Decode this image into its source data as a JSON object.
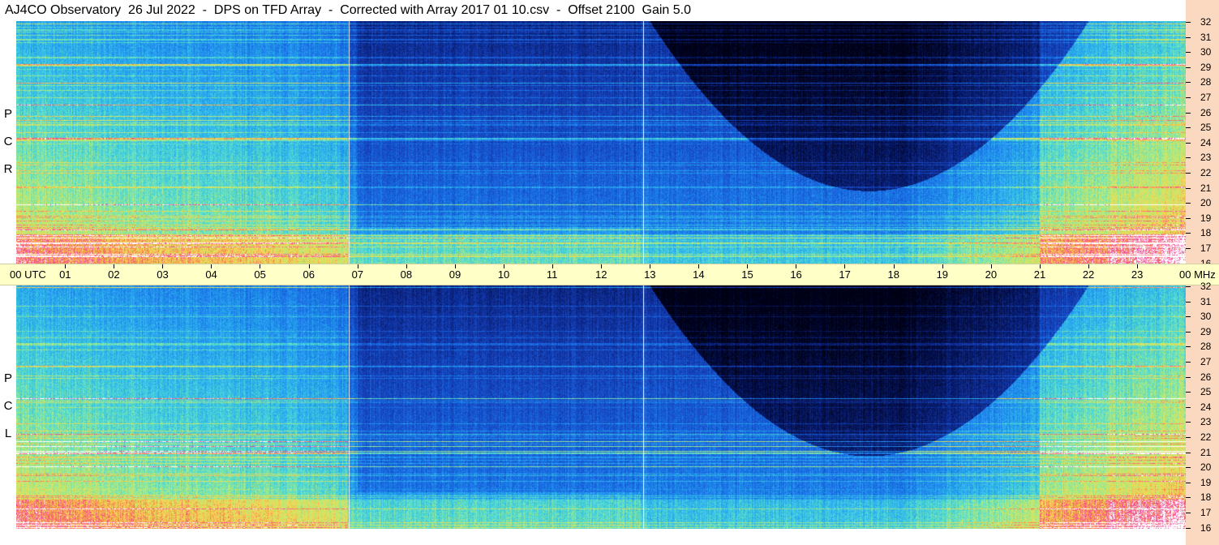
{
  "title": "AJ4CO Observatory  26 Jul 2022  -  DPS on TFD Array  -  Corrected with Array 2017 01 10.csv  -  Offset 2100  Gain 5.0",
  "panels": [
    {
      "name": "rcp",
      "label_letters": [
        "P",
        "C",
        "R"
      ]
    },
    {
      "name": "lcp",
      "label_letters": [
        "P",
        "C",
        "L"
      ]
    }
  ],
  "utc_axis": {
    "first_label": "00 UTC",
    "hour_labels": [
      "01",
      "02",
      "03",
      "04",
      "05",
      "06",
      "07",
      "08",
      "09",
      "10",
      "11",
      "12",
      "13",
      "14",
      "15",
      "16",
      "17",
      "18",
      "19",
      "20",
      "21",
      "22",
      "23"
    ],
    "last_label": "00 MHz"
  },
  "mhz_axis": {
    "labels": [
      "32",
      "31",
      "30",
      "29",
      "28",
      "27",
      "26",
      "25",
      "24",
      "23",
      "22",
      "21",
      "20",
      "19",
      "18",
      "17",
      "16"
    ]
  },
  "colors": {
    "utc_band": "#ffffc8",
    "mhz_band": "#fbd9c0",
    "spectrogram_background": "#0a2a8a"
  }
}
